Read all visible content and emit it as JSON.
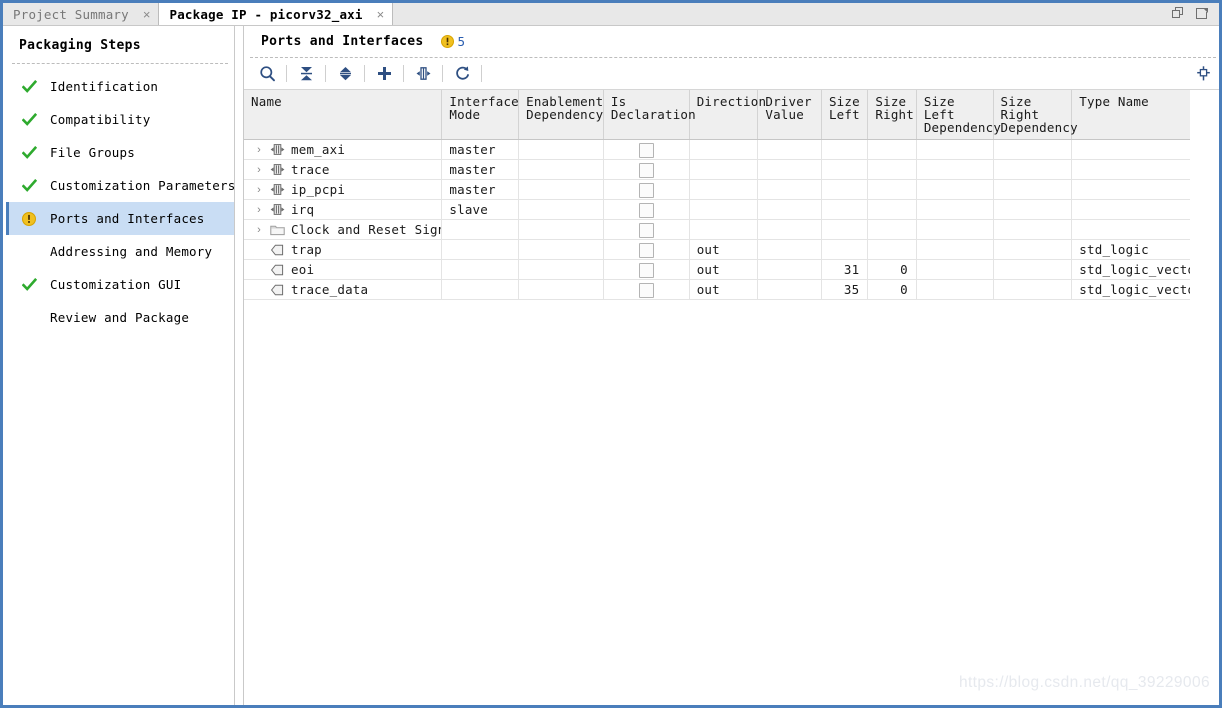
{
  "window": {
    "controls": [
      {
        "name": "restore-window-icon",
        "title": "Restore"
      },
      {
        "name": "maximize-window-icon",
        "title": "Float"
      }
    ]
  },
  "tabs": [
    {
      "label": "Project Summary",
      "active": false,
      "close": "×"
    },
    {
      "label": "Package IP - picorv32_axi",
      "active": true,
      "close": "×"
    }
  ],
  "sidebar": {
    "title": "Packaging Steps",
    "items": [
      {
        "label": "Identification",
        "status": "check",
        "selected": false
      },
      {
        "label": "Compatibility",
        "status": "check",
        "selected": false
      },
      {
        "label": "File Groups",
        "status": "check",
        "selected": false
      },
      {
        "label": "Customization Parameters",
        "status": "check",
        "selected": false
      },
      {
        "label": "Ports and Interfaces",
        "status": "warning",
        "selected": true
      },
      {
        "label": "Addressing and Memory",
        "status": "none",
        "selected": false
      },
      {
        "label": "Customization GUI",
        "status": "check",
        "selected": false
      },
      {
        "label": "Review and Package",
        "status": "none",
        "selected": false
      }
    ]
  },
  "main": {
    "title": "Ports and Interfaces",
    "warning_count": "5",
    "warning_icon": "warning-icon",
    "toolbar": [
      {
        "name": "search-icon",
        "title": "Search"
      },
      {
        "name": "collapse-all-icon",
        "title": "Collapse All"
      },
      {
        "name": "expand-all-icon",
        "title": "Expand All"
      },
      {
        "name": "add-icon",
        "title": "Add"
      },
      {
        "name": "auto-infer-icon",
        "title": "Auto Infer Interface"
      },
      {
        "name": "refresh-icon",
        "title": "Refresh"
      }
    ],
    "pin_icon": "pin-icon",
    "table": {
      "columns": [
        {
          "key": "name",
          "label": "Name"
        },
        {
          "key": "ifm",
          "label": "Interface\nMode"
        },
        {
          "key": "enab",
          "label": "Enablement\nDependency"
        },
        {
          "key": "isdec",
          "label": "Is\nDeclaration"
        },
        {
          "key": "dir",
          "label": "Direction"
        },
        {
          "key": "drv",
          "label": "Driver\nValue"
        },
        {
          "key": "szl",
          "label": "Size\nLeft"
        },
        {
          "key": "szr",
          "label": "Size\nRight"
        },
        {
          "key": "szld",
          "label": "Size Left\nDependency"
        },
        {
          "key": "szrd",
          "label": "Size Right\nDependency"
        },
        {
          "key": "type",
          "label": "Type Name"
        }
      ],
      "rows": [
        {
          "name": "mem_axi",
          "icon": "bus-interface-icon",
          "expandable": true,
          "ifm": "master",
          "enab": "",
          "isdec": false,
          "dir": "",
          "drv": "",
          "szl": "",
          "szr": "",
          "szld": "",
          "szrd": "",
          "type": ""
        },
        {
          "name": "trace",
          "icon": "bus-interface-icon",
          "expandable": true,
          "ifm": "master",
          "enab": "",
          "isdec": false,
          "dir": "",
          "drv": "",
          "szl": "",
          "szr": "",
          "szld": "",
          "szrd": "",
          "type": ""
        },
        {
          "name": "ip_pcpi",
          "icon": "bus-interface-icon",
          "expandable": true,
          "ifm": "master",
          "enab": "",
          "isdec": false,
          "dir": "",
          "drv": "",
          "szl": "",
          "szr": "",
          "szld": "",
          "szrd": "",
          "type": ""
        },
        {
          "name": "irq",
          "icon": "bus-interface-icon",
          "expandable": true,
          "ifm": "slave",
          "enab": "",
          "isdec": false,
          "dir": "",
          "drv": "",
          "szl": "",
          "szr": "",
          "szld": "",
          "szrd": "",
          "type": ""
        },
        {
          "name": "Clock and Reset Signals",
          "icon": "folder-icon",
          "expandable": true,
          "ifm": "",
          "enab": "",
          "isdec": false,
          "dir": "",
          "drv": "",
          "szl": "",
          "szr": "",
          "szld": "",
          "szrd": "",
          "type": ""
        },
        {
          "name": "trap",
          "icon": "output-port-icon",
          "expandable": false,
          "ifm": "",
          "enab": "",
          "isdec": false,
          "dir": "out",
          "drv": "",
          "szl": "",
          "szr": "",
          "szld": "",
          "szrd": "",
          "type": "std_logic"
        },
        {
          "name": "eoi",
          "icon": "output-port-icon",
          "expandable": false,
          "ifm": "",
          "enab": "",
          "isdec": false,
          "dir": "out",
          "drv": "",
          "szl": "31",
          "szr": "0",
          "szld": "",
          "szrd": "",
          "type": "std_logic_vector"
        },
        {
          "name": "trace_data",
          "icon": "output-port-icon",
          "expandable": false,
          "ifm": "",
          "enab": "",
          "isdec": false,
          "dir": "out",
          "drv": "",
          "szl": "35",
          "szr": "0",
          "szld": "",
          "szrd": "",
          "type": "std_logic_vector"
        }
      ],
      "expand_glyph": "›"
    }
  },
  "watermark": "https://blog.csdn.net/qq_39229006",
  "colors": {
    "frame_blue": "#4a7ebb",
    "selection_blue": "#c9ddf4",
    "check_green": "#2eaa2e",
    "warning_yellow": "#f0c020",
    "toolbar_icon": "#2e4f82"
  }
}
